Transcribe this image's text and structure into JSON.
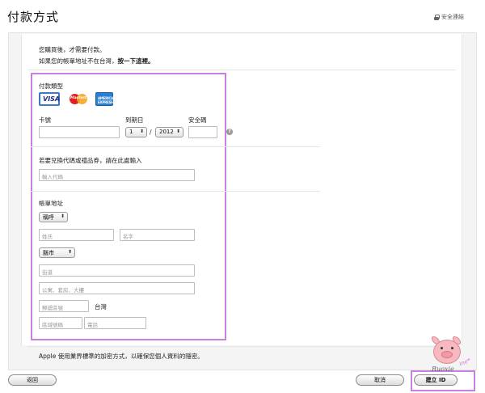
{
  "header": {
    "title": "付款方式",
    "secure_label": "安全連結"
  },
  "intro": {
    "line1": "您購買後，才需要付款。",
    "line2_prefix": "如果您的帳單地址不在台灣，",
    "line2_link": "按一下這裡。"
  },
  "payment": {
    "type_label": "付款類型",
    "cards": [
      "VISA",
      "MasterCard",
      "AMERICAN EXPRESS"
    ],
    "card_number_label": "卡號",
    "expiry_label": "到期日",
    "expiry_month": "1",
    "expiry_separator": "/",
    "expiry_year": "2012",
    "cvv_label": "安全碼",
    "help_icon": "?"
  },
  "promo": {
    "label": "若要兌換代碼或禮品券，請在此處輸入",
    "placeholder": "輸入代碼"
  },
  "billing": {
    "label": "帳單地址",
    "salutation": "稱呼",
    "last_name_placeholder": "姓氏",
    "first_name_placeholder": "名字",
    "city_select": "縣市",
    "street_placeholder": "街道",
    "apt_placeholder": "公寓、套房、大樓",
    "postal_placeholder": "郵遞區號",
    "country": "台灣",
    "area_code_placeholder": "區域號碼",
    "phone_placeholder": "電話"
  },
  "footer": {
    "secure_note": "Apple 使用業界標準的加密方式，以確保您個人資料的隱密。",
    "back_button": "返回",
    "cancel_button": "取消",
    "create_button": "建立 ID"
  },
  "watermark": {
    "text": "Ruoxie",
    "text2": "ine*"
  }
}
